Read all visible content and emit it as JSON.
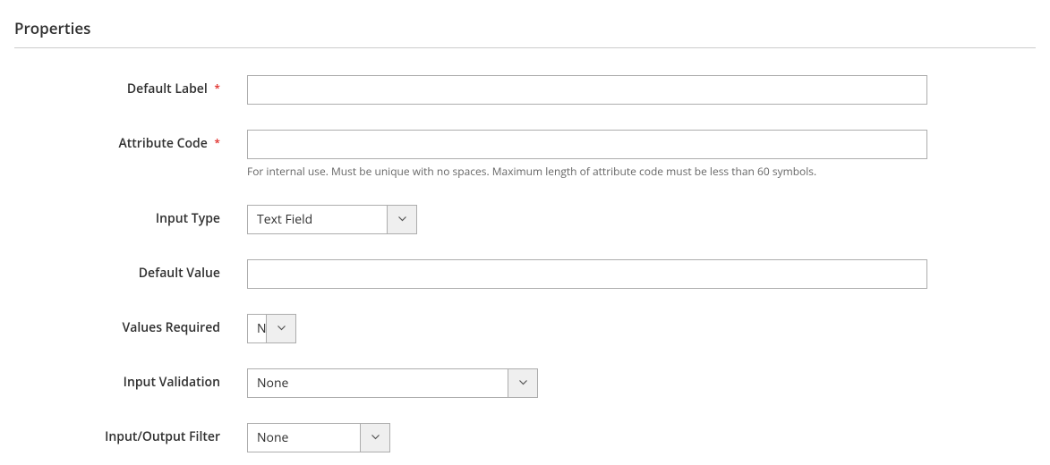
{
  "section_title": "Properties",
  "fields": {
    "default_label": {
      "label": "Default Label",
      "required": "*",
      "value": ""
    },
    "attribute_code": {
      "label": "Attribute Code",
      "required": "*",
      "value": "",
      "note": "For internal use. Must be unique with no spaces. Maximum length of attribute code must be less than 60 symbols."
    },
    "input_type": {
      "label": "Input Type",
      "value": "Text Field"
    },
    "default_value": {
      "label": "Default Value",
      "value": ""
    },
    "values_required": {
      "label": "Values Required",
      "value": "No"
    },
    "input_validation": {
      "label": "Input Validation",
      "value": "None"
    },
    "io_filter": {
      "label": "Input/Output Filter",
      "value": "None"
    }
  }
}
